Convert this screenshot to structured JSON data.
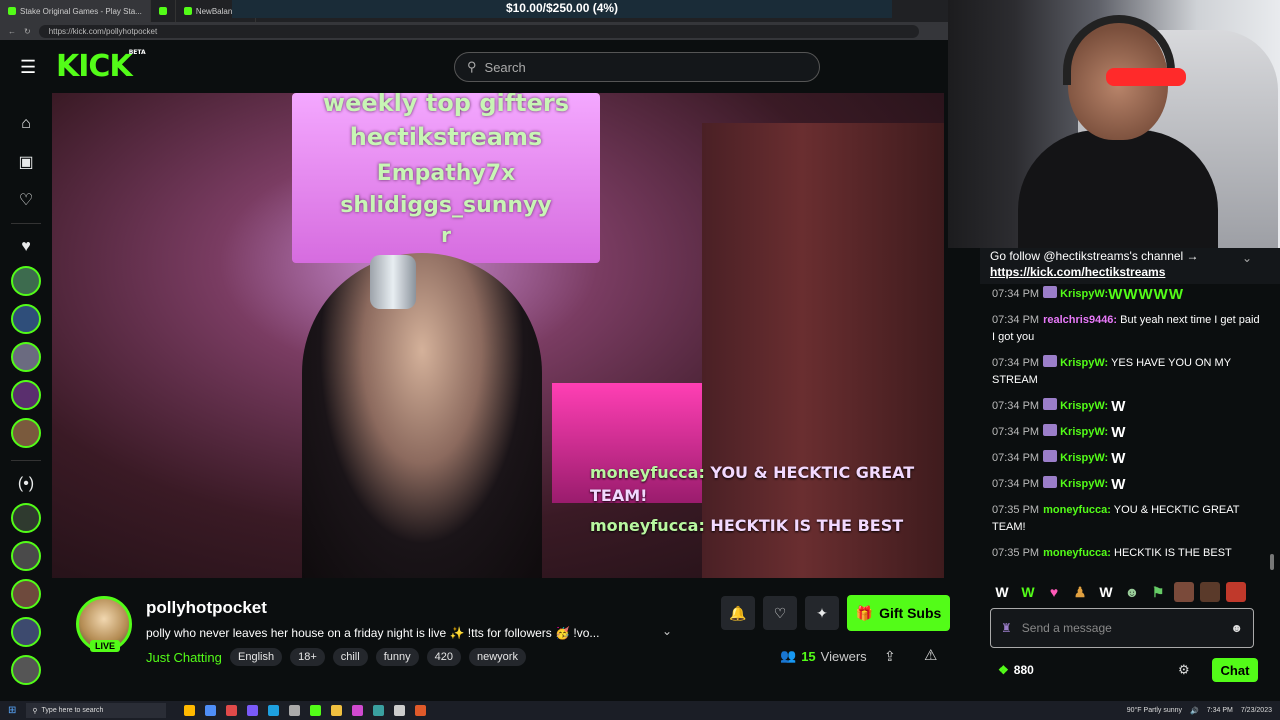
{
  "browser": {
    "tabs": [
      "Stake Original Games - Play Sta...",
      "",
      "NewBalance..."
    ],
    "banner": "$10.00/$250.00 (4%)",
    "url": "https://kick.com/pollyhotpocket"
  },
  "header": {
    "logo": "KICK",
    "beta": "BETA",
    "search_placeholder": "Search"
  },
  "video_overlay": {
    "gifters": [
      "weekly top gifters",
      "hectikstreams",
      "Empathy7x",
      "shlidiggs_sunnyy",
      "r"
    ],
    "chat": [
      {
        "user": "moneyfucca:",
        "text": " YOU & HECKTIC GREAT",
        "cont": "TEAM!"
      },
      {
        "user": "moneyfucca:",
        "text": " HECKTIK IS THE BEST"
      }
    ]
  },
  "stream": {
    "name": "pollyhotpocket",
    "live": "LIVE",
    "title": "polly who never leaves her house on a friday night is live ✨ !tts for followers 🥳 !vo...",
    "category": "Just Chatting",
    "tags": [
      "English",
      "18+",
      "chill",
      "funny",
      "420",
      "newyork"
    ],
    "viewers_count": "15",
    "viewers_label": "Viewers",
    "gift_label": "Gift Subs"
  },
  "chat": {
    "pinned_text": "Go follow @hectikstreams's channel →",
    "pinned_link": "https://kick.com/hectikstreams",
    "messages": [
      {
        "time": "07:34 PM",
        "badge": true,
        "user": "KrispyW:",
        "user_color": "#53fc18",
        "text": "",
        "emote": "WWWWW",
        "emote_class": "green"
      },
      {
        "time": "07:34 PM",
        "badge": false,
        "user": "realchris9446:",
        "user_color": "#e879f9",
        "text": " But yeah next time I get paid I got you",
        "emote": ""
      },
      {
        "time": "07:34 PM",
        "badge": true,
        "user": "KrispyW:",
        "user_color": "#53fc18",
        "text": " YES HAVE YOU ON MY STREAM",
        "emote": ""
      },
      {
        "time": "07:34 PM",
        "badge": true,
        "user": "KrispyW:",
        "user_color": "#53fc18",
        "text": " ",
        "emote": "W"
      },
      {
        "time": "07:34 PM",
        "badge": true,
        "user": "KrispyW:",
        "user_color": "#53fc18",
        "text": " ",
        "emote": "W"
      },
      {
        "time": "07:34 PM",
        "badge": true,
        "user": "KrispyW:",
        "user_color": "#53fc18",
        "text": " ",
        "emote": "W"
      },
      {
        "time": "07:34 PM",
        "badge": true,
        "user": "KrispyW:",
        "user_color": "#53fc18",
        "text": " ",
        "emote": "W"
      },
      {
        "time": "07:35 PM",
        "badge": false,
        "user": "moneyfucca:",
        "user_color": "#53fc18",
        "text": " YOU & HECKTIC GREAT TEAM!",
        "emote": ""
      },
      {
        "time": "07:35 PM",
        "badge": false,
        "user": "moneyfucca:",
        "user_color": "#53fc18",
        "text": " HECKTIK IS THE BEST",
        "emote": ""
      }
    ],
    "input_placeholder": "Send a message",
    "points": "880",
    "send_label": "Chat"
  },
  "taskbar": {
    "search_placeholder": "Type here to search",
    "weather": "90°F Partly sunny",
    "time": "7:34 PM",
    "date": "7/23/2023"
  },
  "colors": {
    "accent": "#53fc18",
    "background": "#0b0e0f",
    "panel": "#24272c"
  }
}
